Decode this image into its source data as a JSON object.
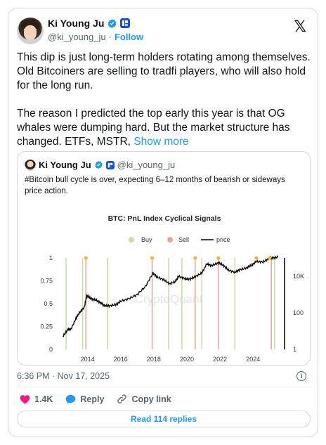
{
  "author": {
    "name": "Ki Young Ju",
    "handle": "@ki_young_ju",
    "follow_label": "Follow",
    "separator": "·"
  },
  "icons": {
    "verified": "verified-badge-icon",
    "affiliate": "affiliate-badge-icon",
    "platform": "x-logo-icon"
  },
  "colors": {
    "accent": "#1d9bf0",
    "like": "#f91880",
    "buy": "#c6e0a0",
    "sell": "#e8a99b",
    "price": "#000000",
    "signal_dot": "#f2b630"
  },
  "tweet": {
    "paragraph1": "This dip is just long-term holders rotating among themselves. Old Bitcoiners are selling to tradfi players, who will also hold for the long run.",
    "paragraph2": "The reason I predicted the top early this year is that OG whales were dumping hard. But the market structure has changed. ETFs, MSTR,",
    "show_more": "Show more"
  },
  "quote": {
    "name": "Ki Young Ju",
    "handle": "@ki_young_ju",
    "text": "#Bitcoin bull cycle is over, expecting 6–12 months of bearish or sideways price action."
  },
  "chart_data": {
    "type": "line",
    "title": "BTC: PnL Index Cyclical Signals",
    "legend": [
      "Buy",
      "Sell",
      "price"
    ],
    "legend_placement": "top-center",
    "watermark": "CryptoQuant",
    "x_ticks": [
      "2014",
      "2016",
      "2018",
      "2020",
      "2022",
      "2024"
    ],
    "y_left_ticks": [
      "0",
      "0.25",
      "0.5",
      "0.75",
      "1"
    ],
    "y_right_ticks": [
      "1",
      "100",
      "10K"
    ],
    "y_right_scale": "log",
    "xlim": [
      2012.4,
      2025.9
    ],
    "ylim_left": [
      0,
      1
    ],
    "ylim_right_log10": [
      0,
      5
    ],
    "buy_signals": [
      2012.7,
      2013.7,
      2015.2,
      2018.9,
      2019.7,
      2020.9,
      2022.9,
      2025.3
    ],
    "sell_signals": [
      2013.9,
      2017.9,
      2020.5,
      2021.9,
      2025.1
    ],
    "signal_dots": [
      2013.9,
      2017.9,
      2020.5,
      2021.9,
      2024.2,
      2025.0
    ],
    "price": {
      "x": [
        2012.5,
        2012.8,
        2013.0,
        2013.3,
        2013.5,
        2013.8,
        2013.95,
        2014.2,
        2014.5,
        2014.8,
        2015.0,
        2015.3,
        2015.7,
        2016.0,
        2016.5,
        2017.0,
        2017.5,
        2017.95,
        2018.2,
        2018.6,
        2018.95,
        2019.3,
        2019.5,
        2019.9,
        2020.2,
        2020.5,
        2020.9,
        2021.2,
        2021.5,
        2021.9,
        2022.2,
        2022.5,
        2022.9,
        2023.2,
        2023.6,
        2023.9,
        2024.2,
        2024.6,
        2024.95,
        2025.2,
        2025.5
      ],
      "y": [
        5,
        12,
        13,
        50,
        100,
        200,
        900,
        600,
        500,
        350,
        250,
        240,
        280,
        430,
        600,
        1000,
        2800,
        15000,
        9000,
        6500,
        3800,
        5200,
        10000,
        7200,
        7000,
        9500,
        15000,
        48000,
        38000,
        55000,
        40000,
        22000,
        16500,
        23000,
        29000,
        40000,
        65000,
        60000,
        95000,
        100000,
        110000
      ]
    }
  },
  "meta": {
    "time": "6:36 PM · Nov 17, 2025"
  },
  "actions": {
    "likes": "1.4K",
    "reply": "Reply",
    "copy": "Copy link"
  },
  "read_replies": "Read 114 replies"
}
